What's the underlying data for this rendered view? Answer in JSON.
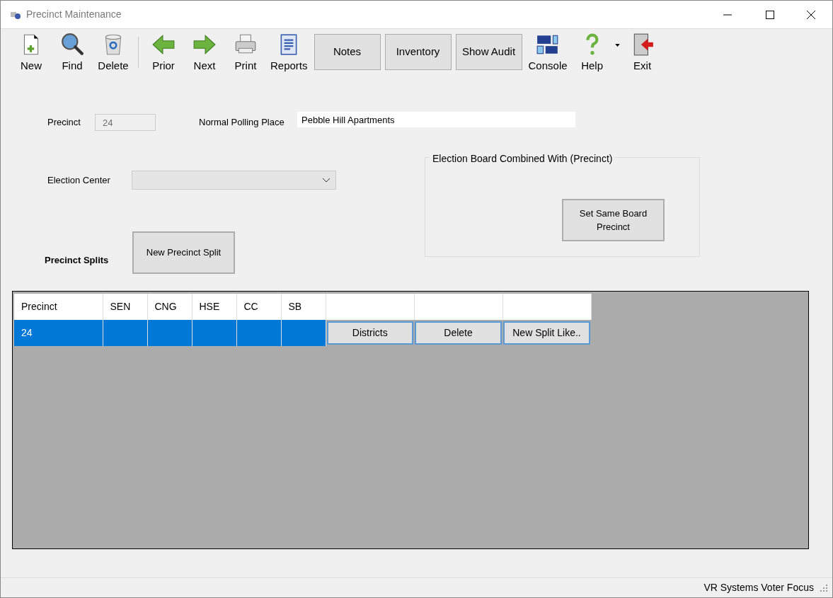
{
  "window": {
    "title": "Precinct Maintenance"
  },
  "toolbar": [
    {
      "kind": "icon",
      "label": "New"
    },
    {
      "kind": "icon",
      "label": "Find"
    },
    {
      "kind": "icon",
      "label": "Delete"
    },
    {
      "kind": "separator"
    },
    {
      "kind": "icon",
      "label": "Prior"
    },
    {
      "kind": "icon",
      "label": "Next"
    },
    {
      "kind": "icon",
      "label": "Print"
    },
    {
      "kind": "icon",
      "label": "Reports"
    },
    {
      "kind": "button",
      "label": "Notes"
    },
    {
      "kind": "button",
      "label": "Inventory"
    },
    {
      "kind": "button",
      "label": "Show Audit"
    },
    {
      "kind": "icon",
      "label": "Console"
    },
    {
      "kind": "split",
      "label": "Help"
    },
    {
      "kind": "icon",
      "label": "Exit"
    }
  ],
  "precinct": {
    "label": "Precinct",
    "value": "24",
    "disabled": true
  },
  "polling_place": {
    "label": "Normal Polling Place",
    "value": "Pebble Hill Apartments"
  },
  "election_center": {
    "label": "Election Center"
  },
  "election_board": {
    "title": "Election Board Combined With (Precinct)",
    "button": "Set Same Board Precinct"
  },
  "splits": {
    "label": "Precinct Splits",
    "button": "New Precinct Split"
  },
  "grid": {
    "columns": [
      "Precinct",
      "SEN",
      "CNG",
      "HSE",
      "CC",
      "SB"
    ],
    "rows": [
      {
        "selected": true,
        "cells": [
          "24",
          "",
          "",
          "",
          "",
          ""
        ],
        "actions": [
          "Districts",
          "Delete",
          "New Split Like.."
        ]
      }
    ]
  },
  "status_bar": {
    "text": "VR Systems Voter Focus"
  }
}
